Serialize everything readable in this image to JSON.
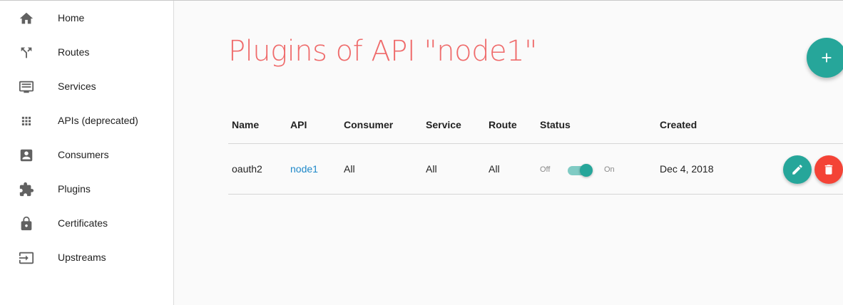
{
  "sidebar": {
    "items": [
      {
        "label": "Home",
        "icon": "home-icon"
      },
      {
        "label": "Routes",
        "icon": "fork-icon"
      },
      {
        "label": "Services",
        "icon": "monitor-list-icon"
      },
      {
        "label": "APIs (deprecated)",
        "icon": "grid-icon"
      },
      {
        "label": "Consumers",
        "icon": "account-box-icon"
      },
      {
        "label": "Plugins",
        "icon": "puzzle-icon"
      },
      {
        "label": "Certificates",
        "icon": "lock-icon"
      },
      {
        "label": "Upstreams",
        "icon": "input-icon"
      }
    ]
  },
  "main": {
    "title": "Plugins of API \"node1\"",
    "add_button_icon": "plus-icon",
    "table": {
      "headers": [
        "Name",
        "API",
        "Consumer",
        "Service",
        "Route",
        "Status",
        "Created"
      ],
      "rows": [
        {
          "name": "oauth2",
          "api": "node1",
          "consumer": "All",
          "service": "All",
          "route": "All",
          "status_off_label": "Off",
          "status_on_label": "On",
          "status_enabled": true,
          "created": "Dec 4, 2018"
        }
      ]
    }
  },
  "colors": {
    "title": "#ef6b6b",
    "accent": "#26a69a",
    "danger": "#f44336",
    "link": "#1e88c9"
  }
}
